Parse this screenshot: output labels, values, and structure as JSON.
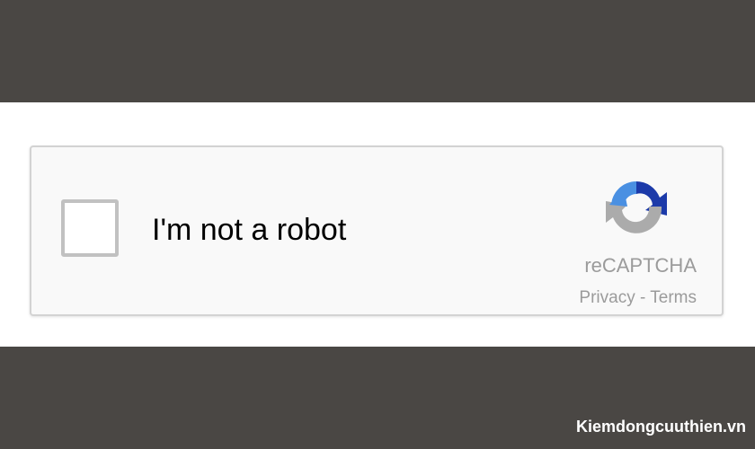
{
  "captcha": {
    "checkbox_label": "I'm not a robot",
    "checked": false,
    "brand": "reCAPTCHA",
    "privacy_label": "Privacy",
    "separator": " - ",
    "terms_label": "Terms",
    "logo_icon": "recaptcha-logo-icon",
    "colors": {
      "logo_blue_dark": "#1c3aa9",
      "logo_blue_light": "#4a90e2",
      "logo_gray": "#ababab",
      "text_gray": "#9b9b9b",
      "box_bg": "#f9f9f9",
      "box_border": "#d3d3d3",
      "checkbox_border": "#c1c1c1"
    }
  },
  "watermark": {
    "text": "Kiemdongcuuthien.vn"
  }
}
